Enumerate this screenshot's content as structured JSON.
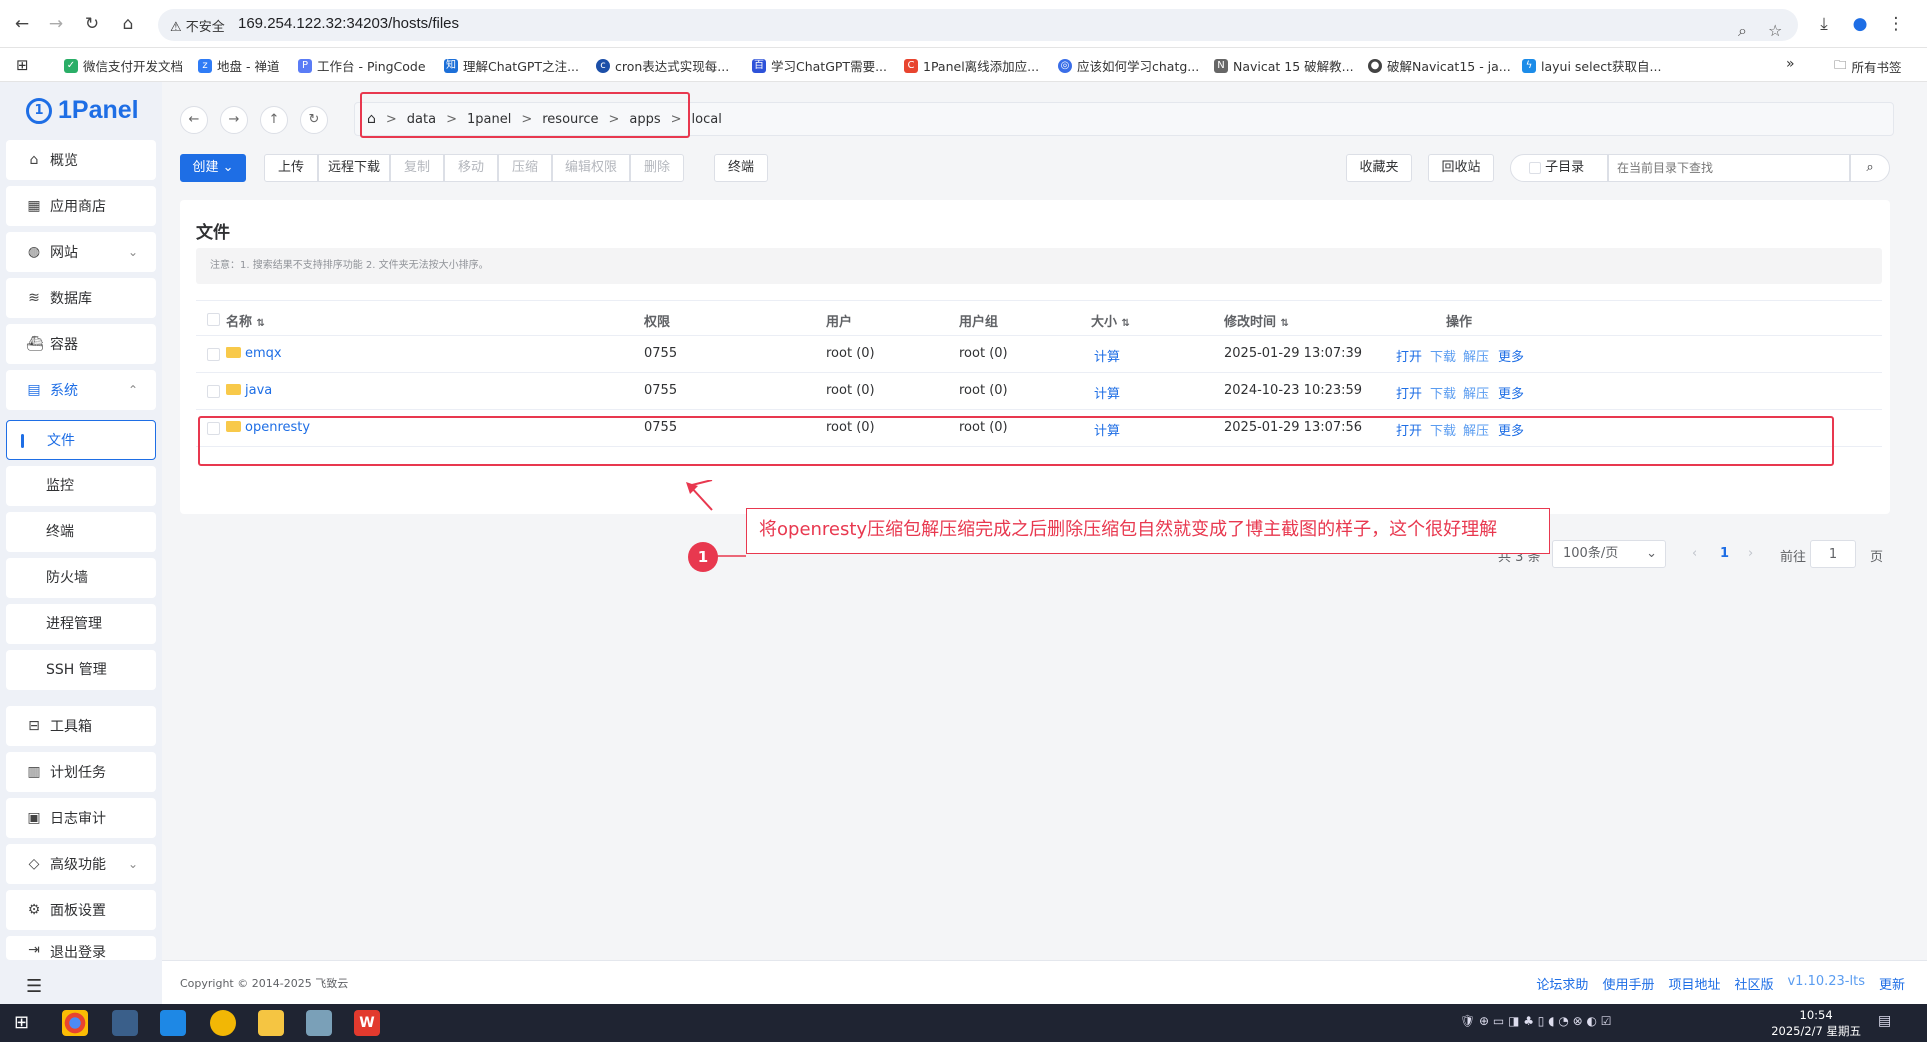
{
  "browser": {
    "security_label": "不安全",
    "url": "169.254.122.32:34203/hosts/files",
    "bookmarks": [
      "微信支付开发文档",
      "地盘 - 禅道",
      "工作台 - PingCode",
      "理解ChatGPT之注...",
      "cron表达式实现每...",
      "学习ChatGPT需要...",
      "1Panel离线添加应...",
      "应该如何学习chatg...",
      "Navicat 15 破解教...",
      "破解Navicat15 - ja...",
      "layui select获取自..."
    ],
    "bookmarks_more": "»",
    "all_bookmarks": "所有书签"
  },
  "sidebar": {
    "logo": "1Panel",
    "items": [
      "概览",
      "应用商店",
      "网站",
      "数据库",
      "容器",
      "系统"
    ],
    "system_sub": [
      "文件",
      "监控",
      "终端",
      "防火墙",
      "进程管理",
      "SSH 管理"
    ],
    "bottom_items": [
      "工具箱",
      "计划任务",
      "日志审计",
      "高级功能",
      "面板设置",
      "退出登录"
    ]
  },
  "breadcrumb": [
    "data",
    "1panel",
    "resource",
    "apps",
    "local"
  ],
  "toolbar": {
    "create": "创建",
    "buttons": [
      "上传",
      "远程下载",
      "复制",
      "移动",
      "压缩",
      "编辑权限",
      "删除"
    ],
    "terminal": "终端",
    "favorites": "收藏夹",
    "recycle": "回收站",
    "subdir": "子目录",
    "search_placeholder": "在当前目录下查找"
  },
  "files": {
    "title": "文件",
    "notice": "注意：1. 搜索结果不支持排序功能 2. 文件夹无法按大小排序。",
    "columns": [
      "名称",
      "权限",
      "用户",
      "用户组",
      "大小",
      "修改时间",
      "操作"
    ],
    "rows": [
      {
        "name": "emqx",
        "perm": "0755",
        "user": "root (0)",
        "group": "root (0)",
        "size": "计算",
        "mtime": "2025-01-29 13:07:39"
      },
      {
        "name": "java",
        "perm": "0755",
        "user": "root (0)",
        "group": "root (0)",
        "size": "计算",
        "mtime": "2024-10-23 10:23:59"
      },
      {
        "name": "openresty",
        "perm": "0755",
        "user": "root (0)",
        "group": "root (0)",
        "size": "计算",
        "mtime": "2025-01-29 13:07:56"
      }
    ],
    "actions": [
      "打开",
      "下载",
      "解压",
      "更多"
    ]
  },
  "pagination": {
    "total": "共 3 条",
    "page_size": "100条/页",
    "current": "1",
    "goto_label": "前往",
    "goto_value": "1",
    "page_unit": "页"
  },
  "annotation": {
    "text": "将openresty压缩包解压缩完成之后删除压缩包自然就变成了博主截图的样子，这个很好理解",
    "number": "1"
  },
  "footer": {
    "copyright": "Copyright © 2014-2025 飞致云",
    "links": [
      "论坛求助",
      "使用手册",
      "项目地址",
      "社区版",
      "v1.10.23-lts",
      "更新"
    ]
  },
  "taskbar": {
    "time": "10:54",
    "date": "2025/2/7 星期五"
  },
  "colors": {
    "accent": "#1e6ee5",
    "annotation": "#e8384f",
    "folder": "#f8c94a"
  }
}
